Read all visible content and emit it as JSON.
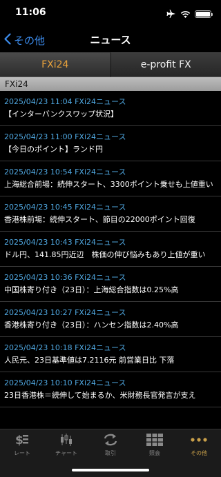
{
  "status": {
    "time": "11:06"
  },
  "nav": {
    "back_label": "その他",
    "title": "ニュース"
  },
  "tabs": [
    {
      "label": "FXi24",
      "active": true
    },
    {
      "label": "e-profit FX",
      "active": false
    }
  ],
  "section": {
    "label": "FXi24"
  },
  "news": [
    {
      "meta": "2025/04/23 11:04 FXi24ニュース",
      "title": "【インターバンクスワップ状況】"
    },
    {
      "meta": "2025/04/23 11:00 FXi24ニュース",
      "title": "【今日のポイント】ランド円"
    },
    {
      "meta": "2025/04/23 10:54 FXi24ニュース",
      "title": "上海総合前場：続伸スタート、3300ポイント乗せも上値重い"
    },
    {
      "meta": "2025/04/23 10:45 FXi24ニュース",
      "title": "香港株前場：続伸スタート、節目の22000ポイント回復"
    },
    {
      "meta": "2025/04/23 10:43 FXi24ニュース",
      "title": "ドル円、141.85円近辺　株価の伸び悩みもあり上値が重い"
    },
    {
      "meta": "2025/04/23 10:36 FXi24ニュース",
      "title": "中国株寄り付き（23日）：上海総合指数は0.25%高"
    },
    {
      "meta": "2025/04/23 10:27 FXi24ニュース",
      "title": "香港株寄り付き（23日）：ハンセン指数は2.40%高"
    },
    {
      "meta": "2025/04/23 10:18 FXi24ニュース",
      "title": "人民元、23日基準値は7.2116元 前営業日比 下落"
    },
    {
      "meta": "2025/04/23 10:10 FXi24ニュース",
      "title": "23日香港株＝続伸して始まるか、米財務長官発言が支え"
    }
  ],
  "tabbar": [
    {
      "label": "レート",
      "icon": "dollar-icon",
      "active": false
    },
    {
      "label": "チャート",
      "icon": "candlestick-icon",
      "active": false
    },
    {
      "label": "取引",
      "icon": "exchange-icon",
      "active": false
    },
    {
      "label": "照会",
      "icon": "grid-icon",
      "active": false
    },
    {
      "label": "その他",
      "icon": "more-icon",
      "active": true
    }
  ],
  "colors": {
    "accent_blue": "#3d8ef0",
    "news_meta": "#4fa7e0",
    "tab_active": "#e9a23b",
    "tabbar_active": "#c9a04a"
  }
}
